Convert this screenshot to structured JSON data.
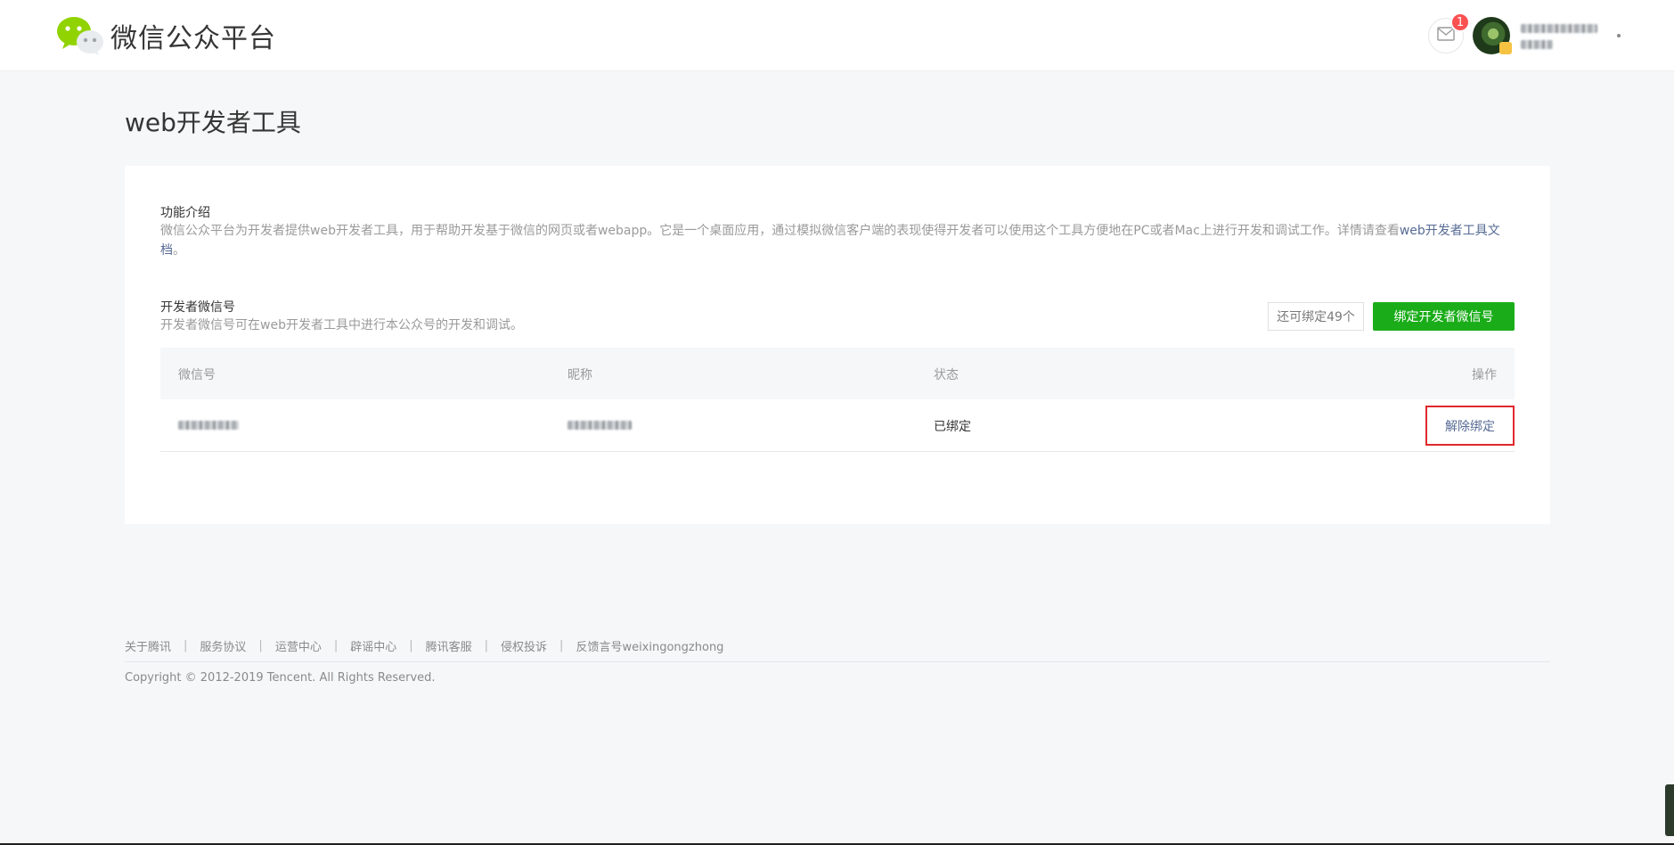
{
  "header": {
    "logo_text": "微信公众平台",
    "message_badge": "1",
    "account_name": "",
    "account_sub": ""
  },
  "page": {
    "title": "web开发者工具"
  },
  "intro": {
    "title": "功能介绍",
    "desc": "微信公众平台为开发者提供web开发者工具，用于帮助开发基于微信的网页或者webapp。它是一个桌面应用，通过模拟微信客户端的表现使得开发者可以使用这个工具方便地在PC或者Mac上进行开发和调试工作。详情请查看",
    "link": "web开发者工具文档",
    "tail": "。"
  },
  "developer": {
    "title": "开发者微信号",
    "desc": "开发者微信号可在web开发者工具中进行本公众号的开发和调试。",
    "count_label": "还可绑定49个",
    "bind_button": "绑定开发者微信号"
  },
  "table": {
    "headers": [
      "微信号",
      "昵称",
      "状态",
      "操作"
    ],
    "rows": [
      {
        "wechat_id": "",
        "nickname": "",
        "status": "已绑定",
        "action": "解除绑定"
      }
    ]
  },
  "footer": {
    "links": [
      "关于腾讯",
      "服务协议",
      "运营中心",
      "辟谣中心",
      "腾讯客服",
      "侵权投诉",
      "反馈言号weixingongzhong"
    ],
    "copyright": "Copyright © 2012-2019 Tencent. All Rights Reserved."
  },
  "colors": {
    "brand_green": "#1aad19",
    "link_blue": "#576b95",
    "highlight_red": "#e0282e",
    "badge_red": "#fa5151"
  }
}
